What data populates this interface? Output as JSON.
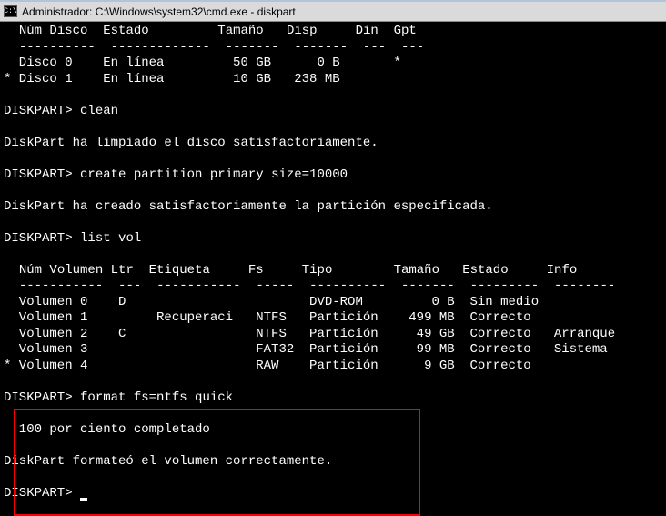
{
  "title": "Administrador: C:\\Windows\\system32\\cmd.exe - diskpart",
  "disk_header": {
    "num": "Núm Disco",
    "estado": "Estado",
    "tamano": "Tamaño",
    "disp": "Disp",
    "din": "Din",
    "gpt": "Gpt"
  },
  "disk_sep": {
    "num": "----------",
    "estado": "-------------",
    "tamano": "-------",
    "disp": "-------",
    "din": "---",
    "gpt": "---"
  },
  "disks": [
    {
      "mark": " ",
      "num": "Disco 0",
      "estado": "En línea",
      "tamano": "50 GB",
      "disp": "0 B",
      "din": " ",
      "gpt": "*"
    },
    {
      "mark": "*",
      "num": "Disco 1",
      "estado": "En línea",
      "tamano": "10 GB",
      "disp": "238 MB",
      "din": " ",
      "gpt": " "
    }
  ],
  "prompt": "DISKPART>",
  "cmd_clean": "clean",
  "msg_clean": "DiskPart ha limpiado el disco satisfactoriamente.",
  "cmd_create": "create partition primary size=10000",
  "msg_create": "DiskPart ha creado satisfactoriamente la partición especificada.",
  "cmd_listvol": "list vol",
  "vol_header": {
    "num": "Núm Volumen",
    "ltr": "Ltr",
    "etiqueta": "Etiqueta",
    "fs": "Fs",
    "tipo": "Tipo",
    "tamano": "Tamaño",
    "estado": "Estado",
    "info": "Info"
  },
  "vol_sep": {
    "num": "-----------",
    "ltr": "---",
    "etiqueta": "-----------",
    "fs": "-----",
    "tipo": "----------",
    "tamano": "-------",
    "estado": "---------",
    "info": "--------"
  },
  "volumes": [
    {
      "mark": " ",
      "num": "Volumen 0",
      "ltr": "D",
      "etiqueta": "",
      "fs": "",
      "tipo": "DVD-ROM",
      "tamano": "0 B",
      "estado": "Sin medio",
      "info": ""
    },
    {
      "mark": " ",
      "num": "Volumen 1",
      "ltr": " ",
      "etiqueta": "Recuperaci",
      "fs": "NTFS",
      "tipo": "Partición",
      "tamano": "499 MB",
      "estado": "Correcto",
      "info": ""
    },
    {
      "mark": " ",
      "num": "Volumen 2",
      "ltr": "C",
      "etiqueta": "",
      "fs": "NTFS",
      "tipo": "Partición",
      "tamano": "49 GB",
      "estado": "Correcto",
      "info": "Arranque"
    },
    {
      "mark": " ",
      "num": "Volumen 3",
      "ltr": " ",
      "etiqueta": "",
      "fs": "FAT32",
      "tipo": "Partición",
      "tamano": "99 MB",
      "estado": "Correcto",
      "info": "Sistema"
    },
    {
      "mark": "*",
      "num": "Volumen 4",
      "ltr": " ",
      "etiqueta": "",
      "fs": "RAW",
      "tipo": "Partición",
      "tamano": "9 GB",
      "estado": "Correcto",
      "info": ""
    }
  ],
  "cmd_format": "format fs=ntfs quick",
  "msg_progress": "  100 por ciento completado",
  "msg_format": "DiskPart formateó el volumen correctamente."
}
